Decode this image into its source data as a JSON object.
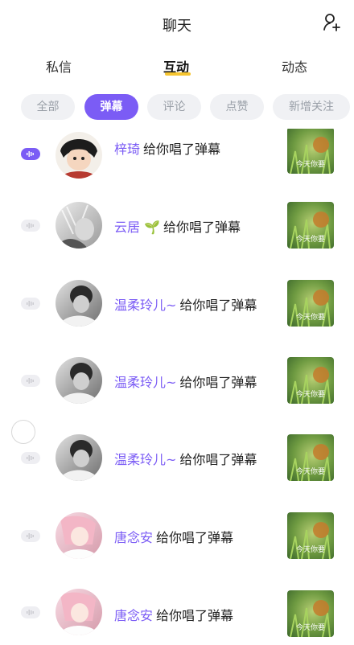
{
  "header": {
    "title": "聊天",
    "add_icon": "add-user-icon"
  },
  "tabs": [
    {
      "label": "私信"
    },
    {
      "label": "互动",
      "active": true
    },
    {
      "label": "动态"
    }
  ],
  "filters": [
    {
      "label": "全部"
    },
    {
      "label": "弹幕",
      "active": true
    },
    {
      "label": "评论"
    },
    {
      "label": "点赞"
    },
    {
      "label": "新增关注"
    }
  ],
  "rows": [
    {
      "name": "梓琦",
      "action": "给你唱了弹幕",
      "voice_active": true
    },
    {
      "name": "云居 🌱",
      "action": "给你唱了弹幕",
      "voice_active": false
    },
    {
      "name": "温柔玲儿~",
      "action": "给你唱了弹幕",
      "voice_active": false
    },
    {
      "name": "温柔玲儿~",
      "action": "给你唱了弹幕",
      "voice_active": false
    },
    {
      "name": "温柔玲儿~",
      "action": "给你唱了弹幕",
      "voice_active": false
    },
    {
      "name": "唐念安",
      "action": "给你唱了弹幕",
      "voice_active": false
    },
    {
      "name": "唐念安",
      "action": "给你唱了弹幕",
      "voice_active": false
    }
  ],
  "thumbnail_caption": "今天你要",
  "colors": {
    "accent": "#7b5cf5",
    "tab_underline": "#f6c531"
  }
}
